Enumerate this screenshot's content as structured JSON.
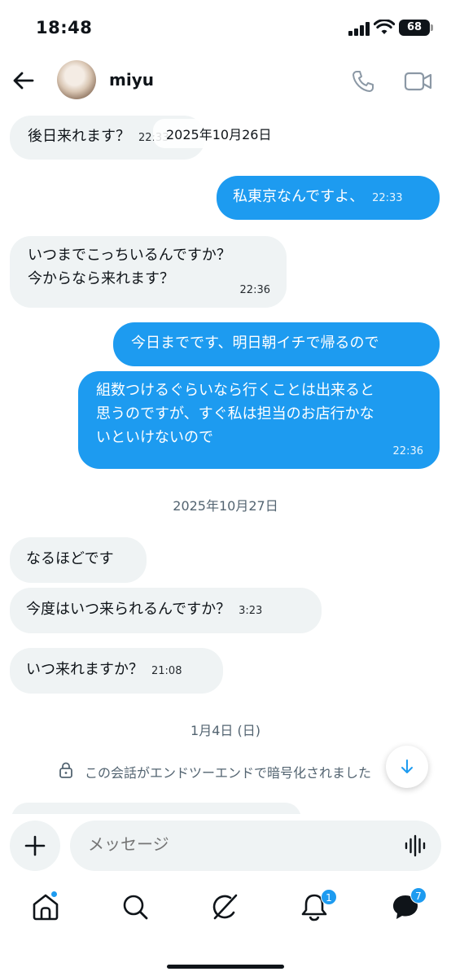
{
  "status_bar": {
    "time": "18:48",
    "battery": "68"
  },
  "header": {
    "contact_name": "miyu"
  },
  "conversation": {
    "sticky_date": "2025年10月26日",
    "messages": [
      {
        "dir": "in",
        "text": "後日来れます？",
        "time": "22:33"
      },
      {
        "dir": "out",
        "text": "私東京なんですよ、",
        "time": "22:33"
      },
      {
        "dir": "in",
        "lines": [
          "いつまでこっちいるんですか？",
          "今からなら来れます？"
        ],
        "time": "22:36"
      },
      {
        "dir": "out",
        "text": "今日までです、明日朝イチで帰るので",
        "time": ""
      },
      {
        "dir": "out",
        "lines": [
          "組数つけるぐらいなら行くことは出来ると",
          "思うのですが、すぐ私は担当のお店行かな",
          "いといけないので"
        ],
        "time": "22:36"
      },
      {
        "dir": "in",
        "text": "なるほどです",
        "time": ""
      },
      {
        "dir": "in",
        "text": "今度はいつ来られるんですか？",
        "time": "3:23"
      },
      {
        "dir": "in",
        "text": "いつ来れますか？",
        "time": "21:08"
      }
    ],
    "date_separators": [
      "2025年10月27日",
      "1月4日 (日)"
    ],
    "e2e_notice": "この会話がエンドツーエンドで暗号化されました"
  },
  "composer": {
    "placeholder": "メッセージ"
  },
  "bottom_nav": {
    "items": [
      {
        "name": "home",
        "icon": "home-icon"
      },
      {
        "name": "search",
        "icon": "search-icon"
      },
      {
        "name": "grok",
        "icon": "grok-icon"
      },
      {
        "name": "notifications",
        "icon": "bell-icon",
        "badge": "1"
      },
      {
        "name": "messages",
        "icon": "messages-icon",
        "badge": "7"
      }
    ]
  },
  "colors": {
    "accent": "#1d9bf0",
    "bubble_in": "#eff3f4",
    "text": "#0f1419",
    "muted": "#536471"
  }
}
